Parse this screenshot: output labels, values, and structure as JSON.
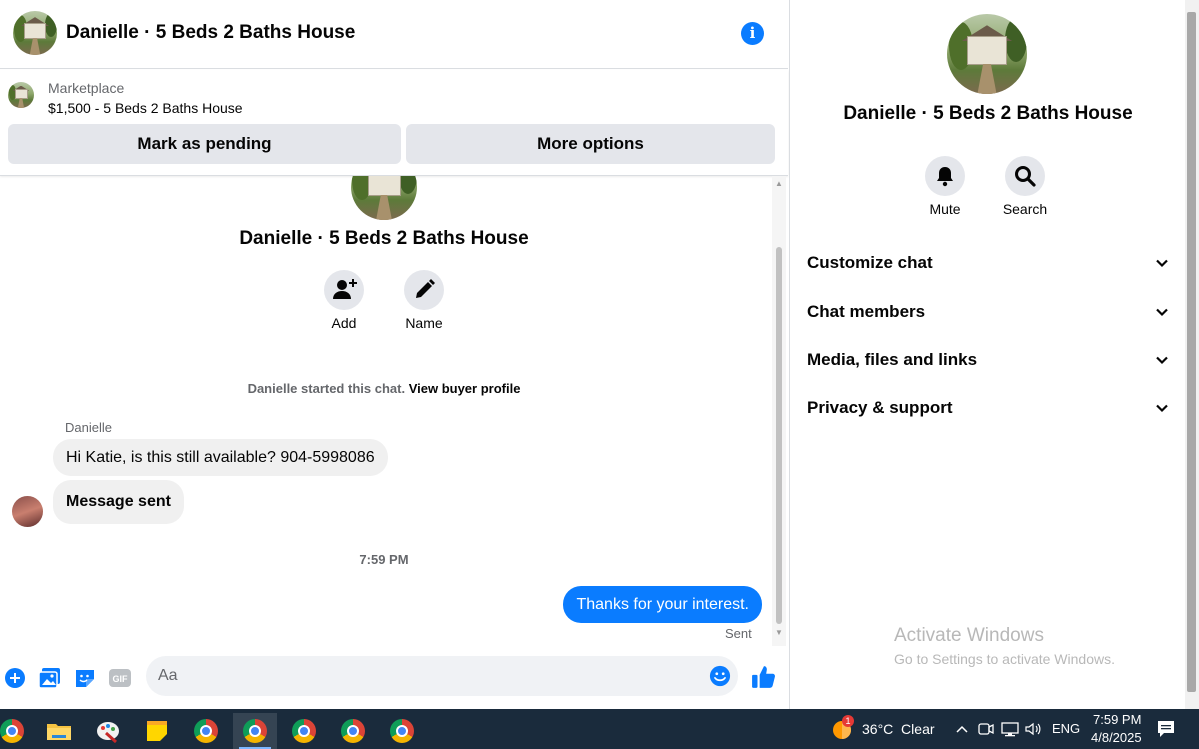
{
  "header": {
    "title": "Danielle · 5 Beds 2 Baths House",
    "info_icon": "info-icon"
  },
  "listing": {
    "source": "Marketplace",
    "price_title": "$1,500 - 5 Beds 2 Baths House",
    "mark_pending_label": "Mark as pending",
    "more_options_label": "More options"
  },
  "conversation": {
    "name": "Danielle · 5 Beds 2 Baths House",
    "actions": [
      {
        "label": "Add",
        "icon": "add-person-icon"
      },
      {
        "label": "Name",
        "icon": "pencil-icon"
      }
    ],
    "started_text": "Danielle started this chat.",
    "buyer_profile_link": "View buyer profile",
    "sender_name": "Danielle",
    "incoming": [
      "Hi Katie, is this still available? 904-5998086",
      "Message sent"
    ],
    "time": "7:59 PM",
    "outgoing": "Thanks for your interest.",
    "status": "Sent"
  },
  "composer": {
    "placeholder": "Aa"
  },
  "info_panel": {
    "title": "Danielle · 5 Beds 2 Baths House",
    "actions": [
      {
        "label": "Mute",
        "icon": "bell-icon"
      },
      {
        "label": "Search",
        "icon": "search-icon"
      }
    ],
    "sections": [
      "Customize chat",
      "Chat members",
      "Media, files and links",
      "Privacy & support"
    ]
  },
  "watermark": {
    "title": "Activate Windows",
    "subtitle": "Go to Settings to activate Windows."
  },
  "taskbar": {
    "weather_badge": "1",
    "weather": "36°C  Clear",
    "language": "ENG",
    "time": "7:59 PM",
    "date": "4/8/2025"
  },
  "colors": {
    "messenger_blue": "#0a7cff",
    "bubble_gray": "#f0f0f0",
    "button_gray": "#e4e6eb",
    "taskbar": "#1a2b3c"
  }
}
